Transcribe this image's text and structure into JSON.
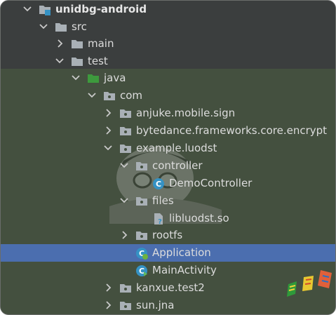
{
  "tree": {
    "rows": [
      {
        "label": "unidbg-android",
        "icon": "module-folder-icon",
        "expanded": true,
        "bold": true
      },
      {
        "label": "src",
        "icon": "folder-icon",
        "expanded": true
      },
      {
        "label": "main",
        "icon": "folder-icon",
        "expanded": false
      },
      {
        "label": "test",
        "icon": "folder-icon",
        "expanded": true
      },
      {
        "label": "java",
        "icon": "test-source-folder-icon",
        "expanded": true
      },
      {
        "label": "com",
        "icon": "package-icon",
        "expanded": true
      },
      {
        "label": "anjuke.mobile.sign",
        "icon": "package-icon",
        "expanded": false
      },
      {
        "label": "bytedance.frameworks.core.encrypt",
        "icon": "package-icon",
        "expanded": false
      },
      {
        "label": "example.luodst",
        "icon": "package-icon",
        "expanded": true
      },
      {
        "label": "controller",
        "icon": "package-icon",
        "expanded": true
      },
      {
        "label": "DemoController",
        "icon": "class-icon"
      },
      {
        "label": "files",
        "icon": "package-icon",
        "expanded": true
      },
      {
        "label": "libluodst.so",
        "icon": "unknown-file-icon"
      },
      {
        "label": "rootfs",
        "icon": "package-icon",
        "expanded": false
      },
      {
        "label": "Application",
        "icon": "spring-class-icon",
        "selected": true
      },
      {
        "label": "MainActivity",
        "icon": "runnable-class-icon"
      },
      {
        "label": "kanxue.test2",
        "icon": "package-icon",
        "expanded": false
      },
      {
        "label": "sun.jna",
        "icon": "package-icon",
        "expanded": false
      }
    ]
  },
  "colors": {
    "panel_top": "#3b3e3e",
    "panel_bottom": "#44503f",
    "selection": "#4b6eaf",
    "text": "#dcdcdc",
    "folder": "#a9b0b6",
    "source_folder": "#3d9a3d",
    "class": "#3592c4"
  }
}
